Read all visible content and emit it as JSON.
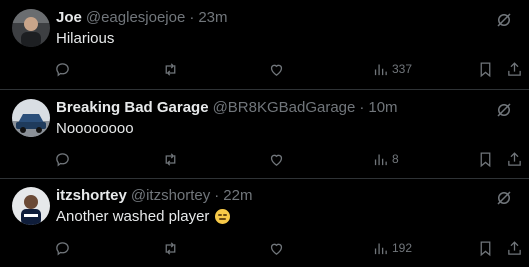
{
  "tweets": [
    {
      "name": "Joe",
      "handle": "@eaglesjoejoe",
      "dot": "·",
      "time": "23m",
      "text": "Hilarious",
      "views": "337",
      "avatar_icon": "joe-avatar"
    },
    {
      "name": "Breaking Bad Garage",
      "handle": "@BR8KGBadGarage",
      "dot": "·",
      "time": "10m",
      "text": "Noooooooo",
      "views": "8",
      "avatar_icon": "car-avatar"
    },
    {
      "name": "itzshortey",
      "handle": "@itzshortey",
      "dot": "·",
      "time": "22m",
      "text": "Another washed player",
      "emoji": "expressionless-face-emoji",
      "views": "192",
      "avatar_icon": "shortey-avatar"
    }
  ],
  "icons": {
    "reply": "reply-icon",
    "retweet": "retweet-icon",
    "like": "like-icon",
    "views": "views-icon",
    "bookmark": "bookmark-icon",
    "share": "share-icon",
    "grok": "grok-icon"
  },
  "colors": {
    "background": "#000000",
    "text": "#e7e9ea",
    "muted": "#71767b",
    "divider": "#2f3336"
  }
}
